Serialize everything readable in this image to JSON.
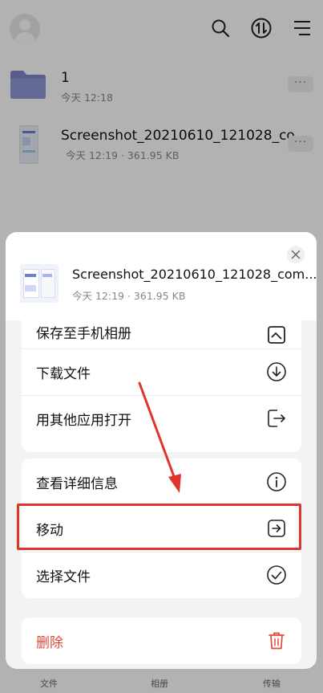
{
  "app_bar": {
    "icons": [
      "avatar",
      "search-icon",
      "transfer-icon",
      "menu-icon"
    ]
  },
  "files": [
    {
      "name": "1",
      "meta": "今天 12:18",
      "icon": "folder-icon"
    },
    {
      "name": "Screenshot_20210610_121028_co...",
      "meta": "今天 12:19 · 361.95 KB",
      "icon": "image-thumbnail"
    }
  ],
  "more_label": "···",
  "bottom_tabs": [
    "文件",
    "相册",
    "传输"
  ],
  "sheet": {
    "file_name": "Screenshot_20210610_121028_com....",
    "file_meta": "今天 12:19 · 361.95 KB",
    "partial_item": "保存至手机相册",
    "group1": [
      {
        "label": "下载文件",
        "icon": "download-icon"
      },
      {
        "label": "用其他应用打开",
        "icon": "open-external-icon"
      }
    ],
    "group2": [
      {
        "label": "查看详细信息",
        "icon": "info-icon"
      },
      {
        "label": "移动",
        "icon": "move-icon"
      },
      {
        "label": "选择文件",
        "icon": "check-circle-icon"
      }
    ],
    "delete": {
      "label": "删除",
      "icon": "trash-icon"
    }
  },
  "colors": {
    "danger": "#e0493a",
    "annotation": "#e0342c",
    "folder": "#7d87c9"
  }
}
